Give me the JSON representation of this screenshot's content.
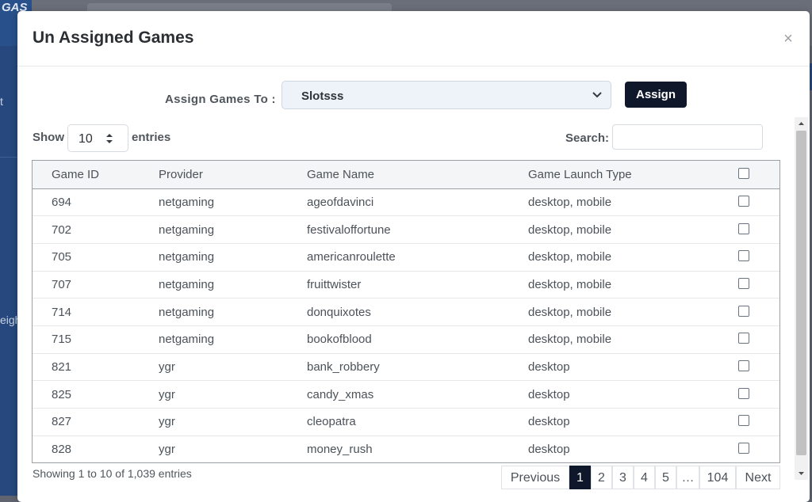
{
  "background": {
    "logo_text": "GAS",
    "sidebar_fragments": [
      "t",
      "eigh"
    ]
  },
  "modal": {
    "title": "Un Assigned Games",
    "close_symbol": "×",
    "assign_label": "Assign Games To :",
    "assign_selected": "Slotsss",
    "assign_button": "Assign",
    "show_label": "Show",
    "entries_value": "10",
    "entries_label": "entries",
    "search_label": "Search:",
    "search_value": ""
  },
  "table": {
    "columns": [
      "Game ID",
      "Provider",
      "Game Name",
      "Game Launch Type"
    ],
    "rows": [
      {
        "id": "694",
        "provider": "netgaming",
        "name": "ageofdavinci",
        "launch": "desktop, mobile"
      },
      {
        "id": "702",
        "provider": "netgaming",
        "name": "festivaloffortune",
        "launch": "desktop, mobile"
      },
      {
        "id": "705",
        "provider": "netgaming",
        "name": "americanroulette",
        "launch": "desktop, mobile"
      },
      {
        "id": "707",
        "provider": "netgaming",
        "name": "fruittwister",
        "launch": "desktop, mobile"
      },
      {
        "id": "714",
        "provider": "netgaming",
        "name": "donquixotes",
        "launch": "desktop, mobile"
      },
      {
        "id": "715",
        "provider": "netgaming",
        "name": "bookofblood",
        "launch": "desktop, mobile"
      },
      {
        "id": "821",
        "provider": "ygr",
        "name": "bank_robbery",
        "launch": "desktop"
      },
      {
        "id": "825",
        "provider": "ygr",
        "name": "candy_xmas",
        "launch": "desktop"
      },
      {
        "id": "827",
        "provider": "ygr",
        "name": "cleopatra",
        "launch": "desktop"
      },
      {
        "id": "828",
        "provider": "ygr",
        "name": "money_rush",
        "launch": "desktop"
      }
    ]
  },
  "footer": {
    "info": "Showing 1 to 10 of 1,039 entries",
    "pagination": {
      "previous": "Previous",
      "pages": [
        "1",
        "2",
        "3",
        "4",
        "5"
      ],
      "ellipsis": "…",
      "last": "104",
      "next": "Next",
      "active_page": "1"
    }
  },
  "colors": {
    "primary_button": "#0f172a",
    "select_background": "#eef3fa",
    "sidebar": "#26487e"
  },
  "icons": {
    "close": "close-icon",
    "select_arrow": "chevron-down-icon",
    "entries_arrow": "sort-icon"
  }
}
